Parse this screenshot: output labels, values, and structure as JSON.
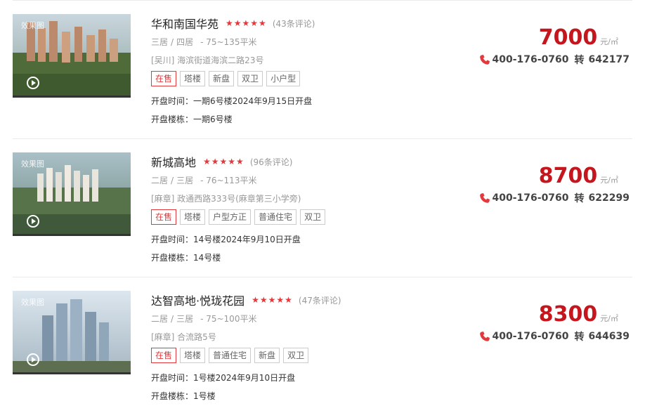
{
  "colors": {
    "accent": "#c5161d",
    "tag_red": "#e4393c",
    "muted": "#999999"
  },
  "listings": [
    {
      "thumb_tag": "效果图",
      "name": "华和南国华苑",
      "stars": "★★★★★",
      "reviews": "(43条评论)",
      "layouts": [
        "三居",
        "四居"
      ],
      "sep": "/",
      "area": "- 75~135平米",
      "address": "[吴川] 海滨街道海滨二路23号",
      "tags": [
        "在售",
        "塔楼",
        "新盘",
        "双卫",
        "小户型"
      ],
      "open_time": "开盘时间：一期6号楼2024年9月15日开盘",
      "open_building": "开盘楼栋：一期6号楼",
      "price": "7000",
      "price_unit": "元/㎡",
      "phone": "400-176-0760",
      "zhuan": "转",
      "ext": "642177",
      "play_icon": "play-icon",
      "phone_icon": "phone-icon"
    },
    {
      "thumb_tag": "效果图",
      "name": "新城高地",
      "stars": "★★★★★",
      "reviews": "(96条评论)",
      "layouts": [
        "二居",
        "三居"
      ],
      "sep": "/",
      "area": "- 76~113平米",
      "address": "[麻章] 政通西路333号(麻章第三小学旁)",
      "tags": [
        "在售",
        "塔楼",
        "户型方正",
        "普通住宅",
        "双卫"
      ],
      "open_time": "开盘时间：14号楼2024年9月10日开盘",
      "open_building": "开盘楼栋：14号楼",
      "price": "8700",
      "price_unit": "元/㎡",
      "phone": "400-176-0760",
      "zhuan": "转",
      "ext": "622299",
      "play_icon": "play-icon",
      "phone_icon": "phone-icon"
    },
    {
      "thumb_tag": "效果图",
      "name": "达智高地·悦珑花园",
      "stars": "★★★★★",
      "reviews": "(47条评论)",
      "layouts": [
        "二居",
        "三居"
      ],
      "sep": "/",
      "area": "- 75~100平米",
      "address": "[麻章] 合流路5号",
      "tags": [
        "在售",
        "塔楼",
        "普通住宅",
        "新盘",
        "双卫"
      ],
      "open_time": "开盘时间：1号楼2024年9月10日开盘",
      "open_building": "开盘楼栋：1号楼",
      "price": "8300",
      "price_unit": "元/㎡",
      "phone": "400-176-0760",
      "zhuan": "转",
      "ext": "644639",
      "play_icon": "play-icon",
      "phone_icon": "phone-icon"
    }
  ]
}
